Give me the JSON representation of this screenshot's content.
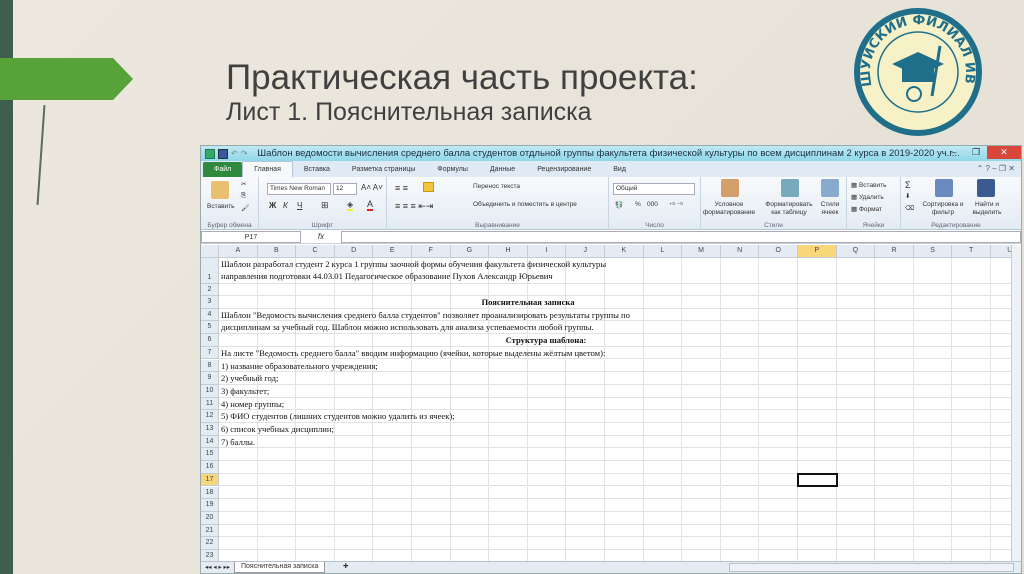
{
  "slide": {
    "title": "Практическая часть проекта:",
    "subtitle": "Лист 1. Пояснительная записка",
    "logo_text": "ШУЙСКИЙ ФИЛИАЛ ИВГУ",
    "colors": {
      "sidebar": "#3f5e4e",
      "arrow": "#57a33a",
      "logo": "#1f6f8b"
    }
  },
  "excel": {
    "window_title": "Шаблон ведомости вычисления среднего балла студентов отдльной группы факультета физической культуры по всем дисциплинам 2 курса в 2019-2020 уч.г...",
    "tabs": [
      "Файл",
      "Главная",
      "Вставка",
      "Разметка страницы",
      "Формулы",
      "Данные",
      "Рецензирование",
      "Вид"
    ],
    "ribbon": {
      "paste": "Вставить",
      "clipboard": "Буфер обмена",
      "font_name": "Times New Roman",
      "font_size": "12",
      "bold": "Ж",
      "italic": "К",
      "underline": "Ч",
      "font_group": "Шрифт",
      "wrap_text": "Перенос текста",
      "merge_center": "Объединить и поместить в центре",
      "alignment_group": "Выравнивание",
      "number_format": "Общий",
      "percent": "%",
      "thousands": "000",
      "number_group": "Число",
      "cond_format": "Условное форматирование",
      "format_table": "Форматировать как таблицу",
      "cell_styles": "Стили ячеек",
      "styles_group": "Стили",
      "insert": "Вставить",
      "delete": "Удалить",
      "format": "Формат",
      "cells_group": "Ячейки",
      "sort_filter": "Сортировка и фильтр",
      "find_select": "Найти и выделить",
      "editing_group": "Редактирование"
    },
    "name_box": "P17",
    "fx": "fx",
    "columns": [
      "A",
      "B",
      "C",
      "D",
      "E",
      "F",
      "G",
      "H",
      "I",
      "J",
      "K",
      "L",
      "M",
      "N",
      "O",
      "P",
      "Q",
      "R",
      "S",
      "T",
      "U"
    ],
    "rows": [
      "1",
      "2",
      "3",
      "4",
      "5",
      "6",
      "7",
      "8",
      "9",
      "10",
      "11",
      "12",
      "13",
      "14",
      "15",
      "16",
      "17",
      "18",
      "19",
      "20",
      "21",
      "22",
      "23"
    ],
    "selected_row": "17",
    "selected_col": "P",
    "cells": {
      "r1a": "Шаблон разработал студент 2 курса 1 группы заочной формы обучения факультета физической культуры",
      "r1b": "направления подготовки 44.03.01 Педагогическое образование Пухов Александр Юрьевич",
      "r3": "Пояснительная записка",
      "r4": "Шаблон \"Ведомость вычисления среднего балла студентов\" позволяет проанализировать результаты группы по",
      "r5": "дисциплинам за учебный год. Шаблон можно использовать для анализа успеваемости любой группы.",
      "r6": "Структура шаблона:",
      "r7": "На листе \"Ведомость среднего балла\" вводим информацию (ячейки, которые выделены жёлтым цветом):",
      "r8": "1) название образовательного учреждения;",
      "r9": "2) учебный год;",
      "r10": "3) факультет;",
      "r11": "4) номер группы;",
      "r12": "5) ФИО студентов (лишних студентов можно удалить из ячеек);",
      "r13": "6) список учебных дисциплин;",
      "r14": "7) баллы."
    },
    "sheet_tab": "Пояснительная записка"
  }
}
